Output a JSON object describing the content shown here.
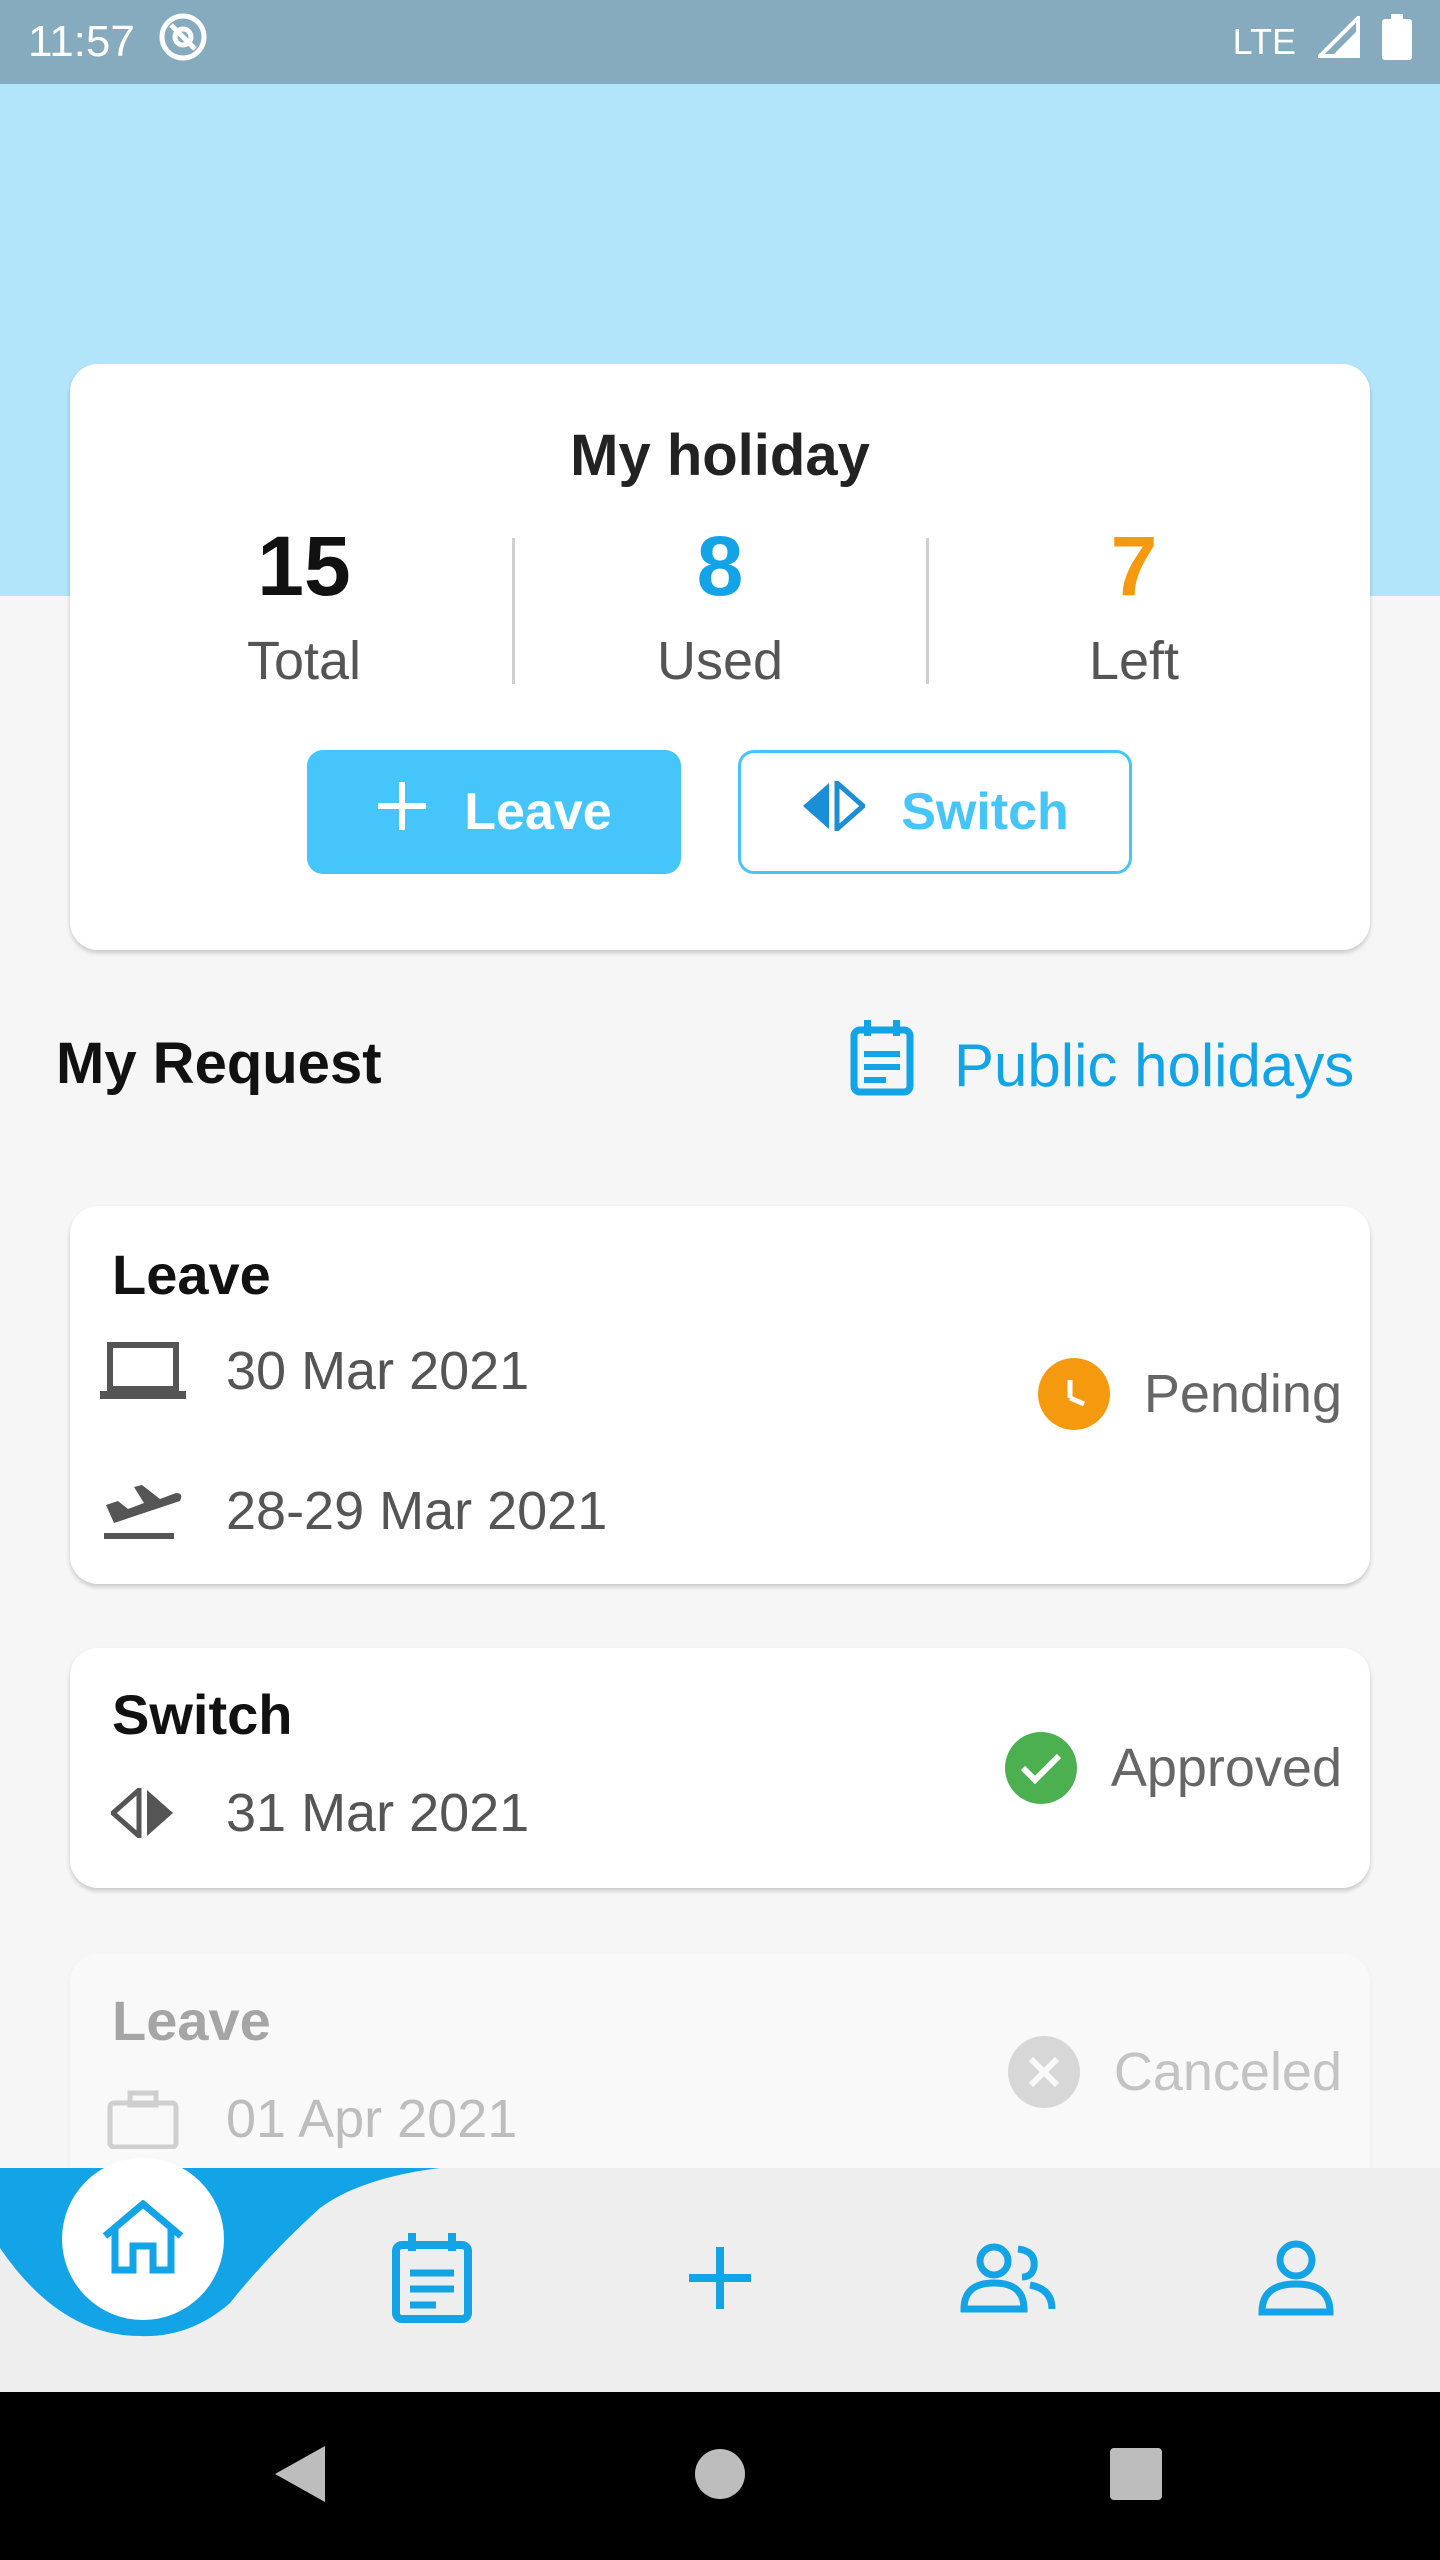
{
  "status_bar": {
    "time": "11:57",
    "network": "LTE"
  },
  "holiday": {
    "title": "My holiday",
    "total_value": "15",
    "total_label": "Total",
    "used_value": "8",
    "used_label": "Used",
    "left_value": "7",
    "left_label": "Left",
    "leave_button": "Leave",
    "switch_button": "Switch"
  },
  "requests_section": {
    "title": "My Request",
    "public_holidays_link": "Public holidays"
  },
  "requests": [
    {
      "type": "Leave",
      "line1": "30 Mar 2021",
      "line2": "28-29 Mar 2021",
      "status": "Pending",
      "icon1": "laptop-icon",
      "icon2": "airplane-departure-icon",
      "status_icon": "clock-icon"
    },
    {
      "type": "Switch",
      "line1": "31 Mar 2021",
      "status": "Approved",
      "icon1": "switch-arrows-icon",
      "status_icon": "check-icon"
    },
    {
      "type": "Leave",
      "line1": "01 Apr 2021",
      "status": "Canceled",
      "icon1": "briefcase-icon",
      "status_icon": "close-icon"
    }
  ],
  "nav": [
    "home-icon",
    "calendar-icon",
    "plus-icon",
    "people-icon",
    "person-icon"
  ],
  "colors": {
    "accent": "#13a4e8",
    "pending": "#f59a0e",
    "approved": "#4caf50",
    "canceled": "#9e9e9e"
  }
}
